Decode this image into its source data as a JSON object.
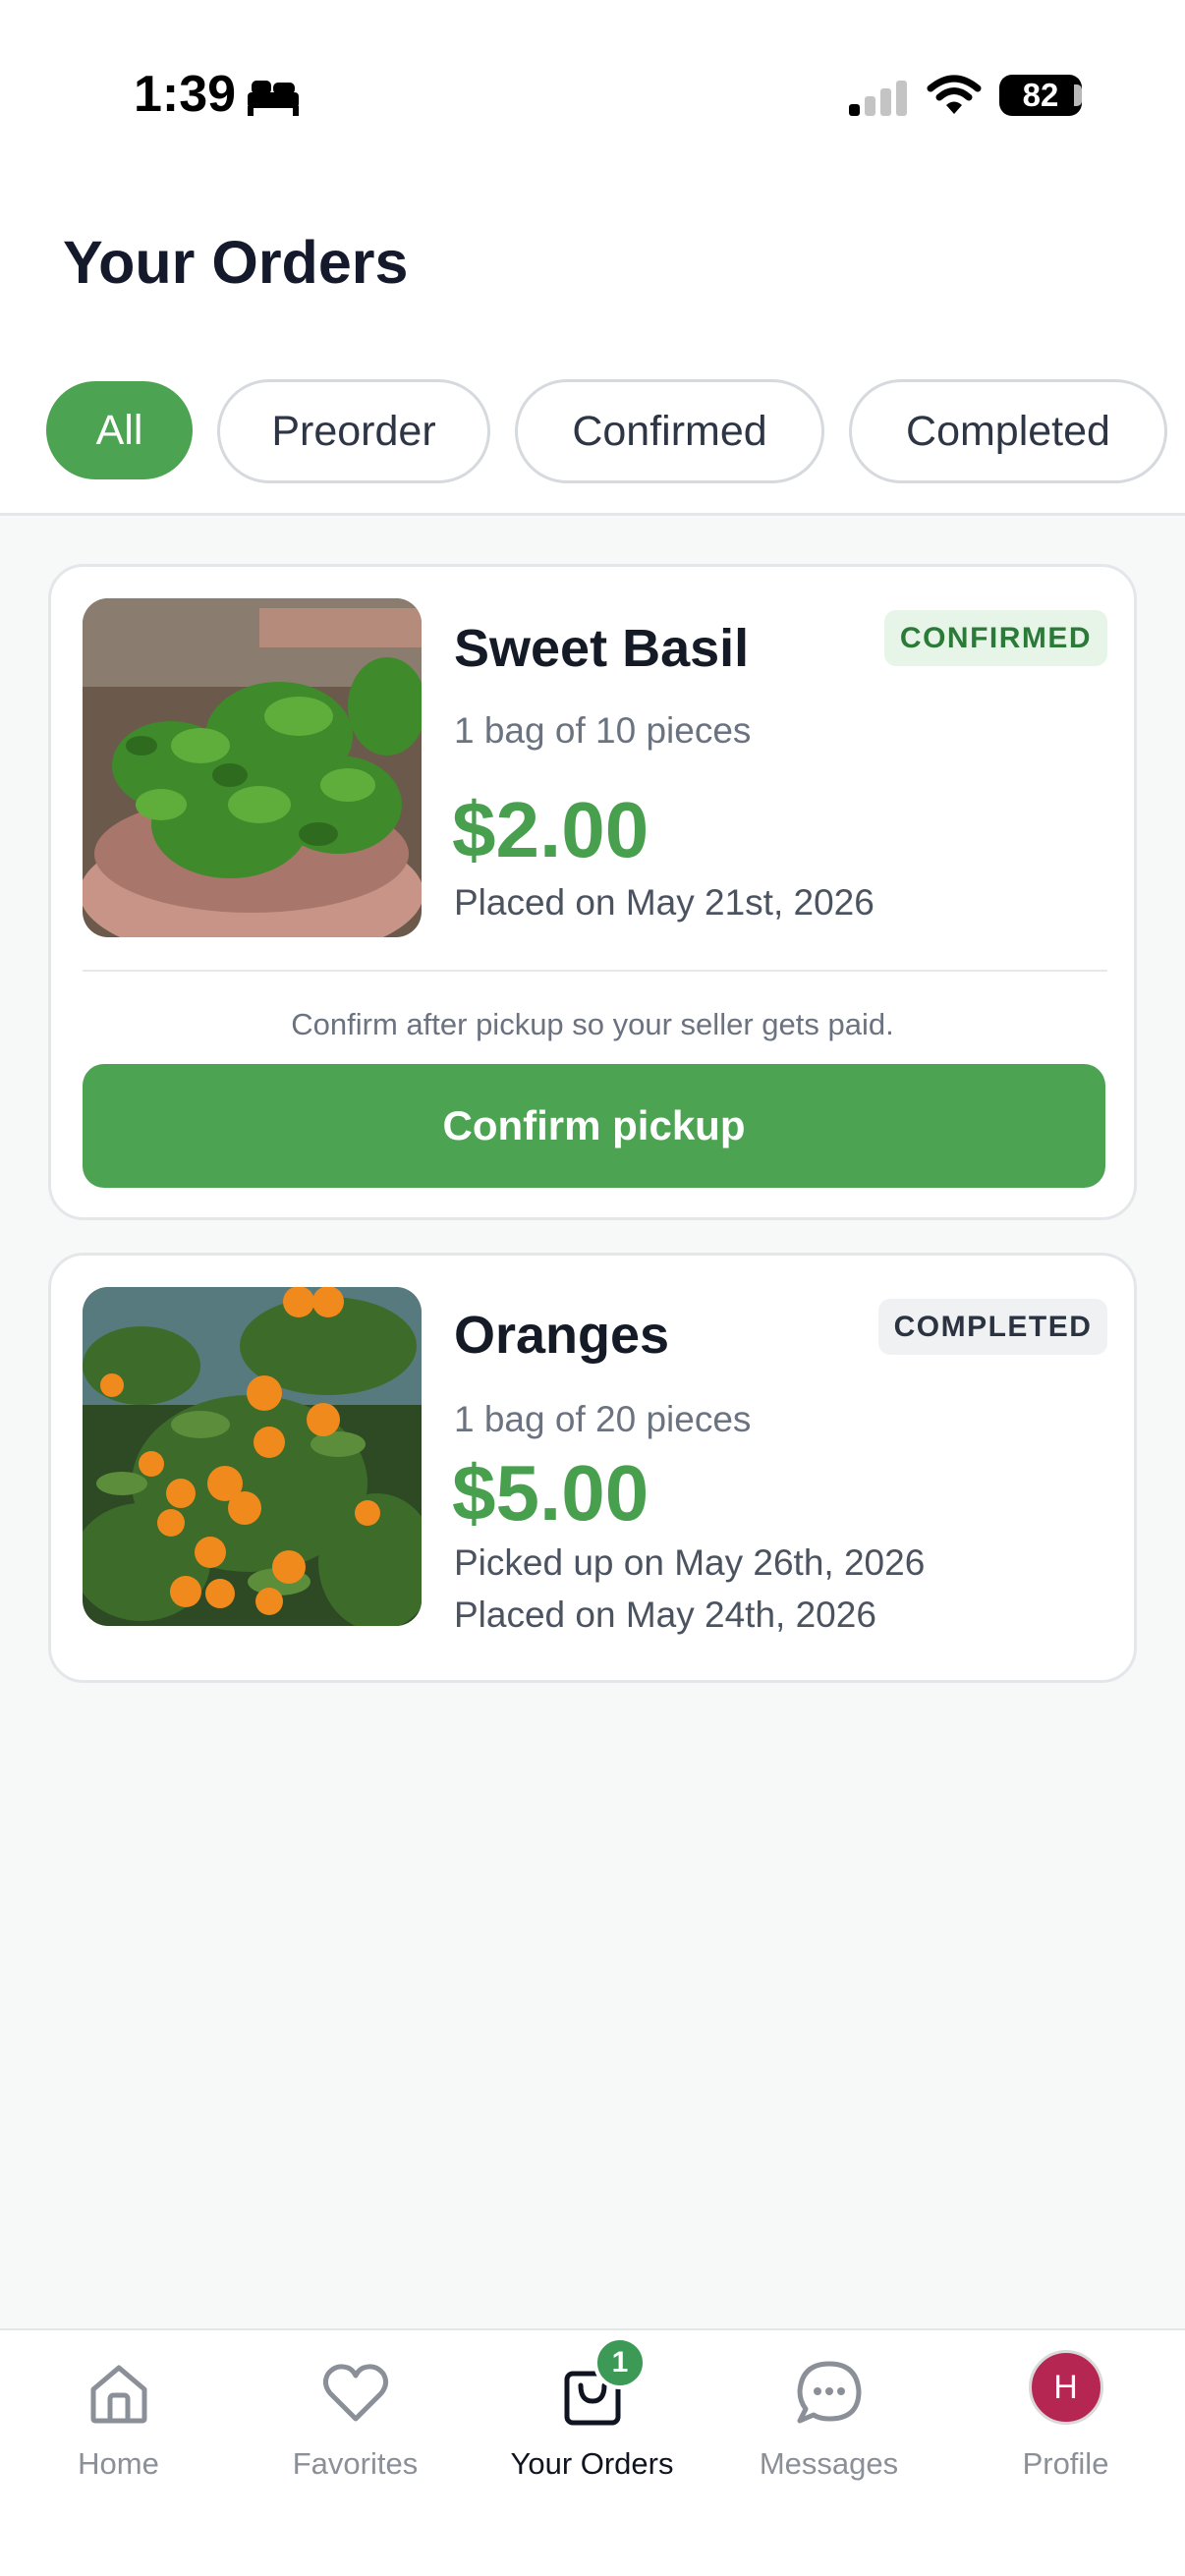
{
  "status_bar": {
    "time": "1:39",
    "battery": "82"
  },
  "header": {
    "title": "Your Orders"
  },
  "filters": [
    {
      "label": "All",
      "active": true
    },
    {
      "label": "Preorder",
      "active": false
    },
    {
      "label": "Confirmed",
      "active": false
    },
    {
      "label": "Completed",
      "active": false
    }
  ],
  "orders": [
    {
      "name": "Sweet Basil",
      "status": "CONFIRMED",
      "quantity": "1 bag of 10 pieces",
      "price": "$2.00",
      "placed": "Placed on May 21st, 2026",
      "hint": "Confirm after pickup so your seller gets paid.",
      "action_label": "Confirm pickup"
    },
    {
      "name": "Oranges",
      "status": "COMPLETED",
      "quantity": "1 bag of 20 pieces",
      "price": "$5.00",
      "picked_up": "Picked up on May 26th, 2026",
      "placed": "Placed on May 24th, 2026"
    }
  ],
  "tab_bar": {
    "tabs": [
      {
        "label": "Home",
        "icon": "home-icon"
      },
      {
        "label": "Favorites",
        "icon": "heart-icon"
      },
      {
        "label": "Your Orders",
        "icon": "shopping-bag-icon",
        "active": true,
        "badge": "1"
      },
      {
        "label": "Messages",
        "icon": "chat-bubble-icon"
      },
      {
        "label": "Profile",
        "icon": "avatar",
        "avatar_initial": "H"
      }
    ]
  },
  "colors": {
    "accent": "#4ca452",
    "price": "#48a04f",
    "confirmed_badge_bg": "#e6f5e8",
    "avatar": "#b52653"
  }
}
